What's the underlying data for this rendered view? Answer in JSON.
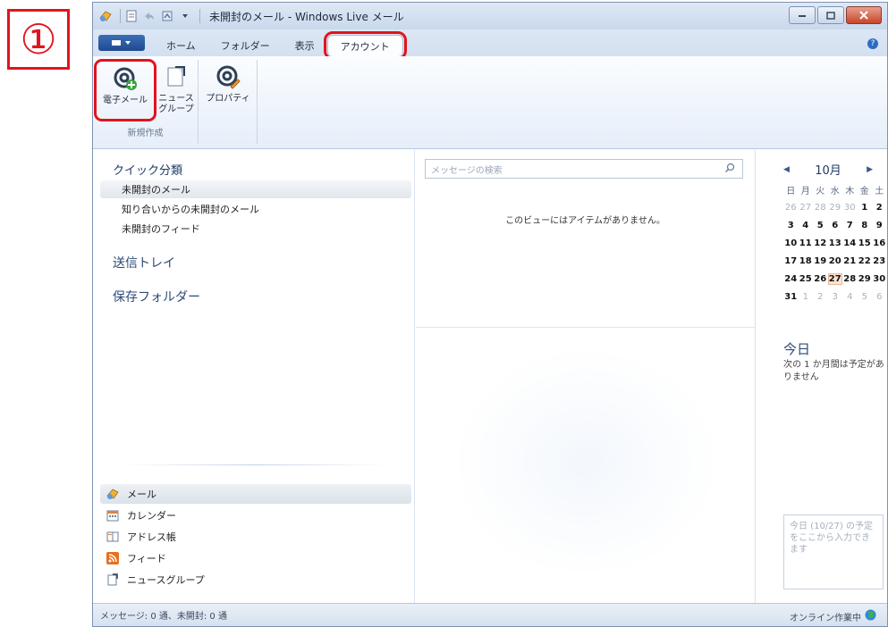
{
  "step_marker": "①",
  "titlebar": {
    "title": "未開封のメール - Windows Live メール"
  },
  "ribbon_tabs": {
    "app_menu_icon": "app-menu-icon",
    "tabs": [
      "ホーム",
      "フォルダー",
      "表示",
      "アカウント"
    ],
    "highlighted_tab": "アカウント"
  },
  "ribbon": {
    "email_label": "電子メール",
    "newsgroup_label_1": "ニュース",
    "newsgroup_label_2": "グループ",
    "properties_label": "プロパティ",
    "group_label": "新規作成"
  },
  "left_pane": {
    "quick_title": "クイック分類",
    "quick_items": [
      "未開封のメール",
      "知り合いからの未開封のメール",
      "未開封のフィード"
    ],
    "outbox": "送信トレイ",
    "storage": "保存フォルダー",
    "nav_items": [
      "メール",
      "カレンダー",
      "アドレス帳",
      "フィード",
      "ニュースグループ"
    ]
  },
  "middle_pane": {
    "search_placeholder": "メッセージの検索",
    "empty_message": "このビューにはアイテムがありません。"
  },
  "calendar": {
    "month": "10月",
    "weekdays": [
      "日",
      "月",
      "火",
      "水",
      "木",
      "金",
      "土"
    ],
    "weeks": [
      [
        "26",
        "27",
        "28",
        "29",
        "30",
        "1",
        "2"
      ],
      [
        "3",
        "4",
        "5",
        "6",
        "7",
        "8",
        "9"
      ],
      [
        "10",
        "11",
        "12",
        "13",
        "14",
        "15",
        "16"
      ],
      [
        "17",
        "18",
        "19",
        "20",
        "21",
        "22",
        "23"
      ],
      [
        "24",
        "25",
        "26",
        "27",
        "28",
        "29",
        "30"
      ],
      [
        "31",
        "1",
        "2",
        "3",
        "4",
        "5",
        "6"
      ]
    ],
    "today_heading": "今日",
    "today_message": "次の 1 か月間は予定がありません",
    "quick_add": "今日 (10/27) の予定をここから入力できます"
  },
  "statusbar": {
    "left": "メッセージ: 0 通、未開封: 0 通",
    "right": "オンライン作業中"
  },
  "colors": {
    "highlight_red": "#e0141e",
    "accent_blue": "#2d4a78"
  }
}
